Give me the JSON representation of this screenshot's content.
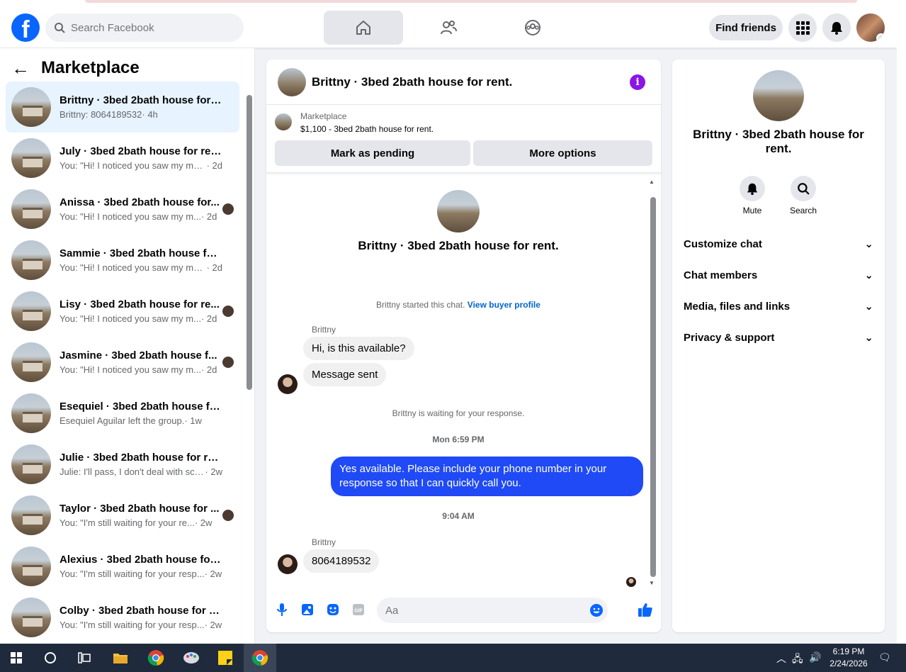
{
  "topbar": {
    "logo": "f",
    "search_placeholder": "Search Facebook",
    "find_friends": "Find friends",
    "icons": [
      "home-icon",
      "friends-icon",
      "groups-icon",
      "menu-grid-icon",
      "bell-icon"
    ],
    "accent": "#0866ff"
  },
  "sidebar": {
    "title": "Marketplace",
    "conversations": [
      {
        "title": "Brittny · 3bed 2bath house for r...",
        "snippet": "Brittny: 8064189532",
        "time": "· 4h",
        "active": true,
        "mini": false
      },
      {
        "title": "July · 3bed 2bath house for rent.",
        "snippet": "You: \"Hi! I noticed you saw my mes...",
        "time": "· 2d",
        "mini": false
      },
      {
        "title": "Anissa · 3bed 2bath house for...",
        "snippet": "You: \"Hi! I noticed you saw my m...",
        "time": "· 2d",
        "mini": true
      },
      {
        "title": "Sammie · 3bed 2bath house for ...",
        "snippet": "You: \"Hi! I noticed you saw my mes...",
        "time": "· 2d",
        "mini": false
      },
      {
        "title": "Lisy · 3bed 2bath house for re...",
        "snippet": "You: \"Hi! I noticed you saw my m...",
        "time": "· 2d",
        "mini": true
      },
      {
        "title": "Jasmine · 3bed 2bath house f...",
        "snippet": "You: \"Hi! I noticed you saw my m...",
        "time": "· 2d",
        "mini": true
      },
      {
        "title": "Esequiel · 3bed 2bath house for ...",
        "snippet": "Esequiel Aguilar left the group.",
        "time": "· 1w",
        "mini": false
      },
      {
        "title": "Julie · 3bed 2bath house for rent.",
        "snippet": "Julie: I'll pass, I don't deal with sca...",
        "time": "· 2w",
        "mini": false
      },
      {
        "title": "Taylor · 3bed 2bath house for ...",
        "snippet": "You: \"I'm still waiting for your re...",
        "time": "· 2w",
        "mini": true
      },
      {
        "title": "Alexius · 3bed 2bath house for r...",
        "snippet": "You: \"I'm still waiting for your resp...",
        "time": "· 2w",
        "mini": false
      },
      {
        "title": "Colby · 3bed 2bath house for rent.",
        "snippet": "You: \"I'm still waiting for your resp...",
        "time": "· 2w",
        "mini": false
      }
    ]
  },
  "chat": {
    "header_title": "Brittny · 3bed 2bath house for rent.",
    "listing_source": "Marketplace",
    "listing_price": "$1,100 - 3bed 2bath house for rent.",
    "mark_pending": "Mark as pending",
    "more_options": "More options",
    "profile_title": "Brittny · 3bed 2bath house for rent.",
    "started_text": "Brittny started this chat.",
    "view_profile": "View buyer profile",
    "sender1": "Brittny",
    "msg1": "Hi, is this available?",
    "msg2": "Message sent",
    "waiting": "Brittny is waiting for your response.",
    "time1": "Mon 6:59 PM",
    "my_msg": "Yes available. Please include your phone number in your response so that I can quickly call you.",
    "time2": "9:04 AM",
    "sender2": "Brittny",
    "msg3": "8064189532",
    "composer_placeholder": "Aa",
    "bubble_color": "#1f4af5"
  },
  "rpanel": {
    "title": "Brittny · 3bed 2bath house for rent.",
    "mute": "Mute",
    "search": "Search",
    "sections": [
      "Customize chat",
      "Chat members",
      "Media, files and links",
      "Privacy & support"
    ]
  },
  "taskbar": {
    "time": "6:19 PM",
    "date": "2/24/2026"
  }
}
